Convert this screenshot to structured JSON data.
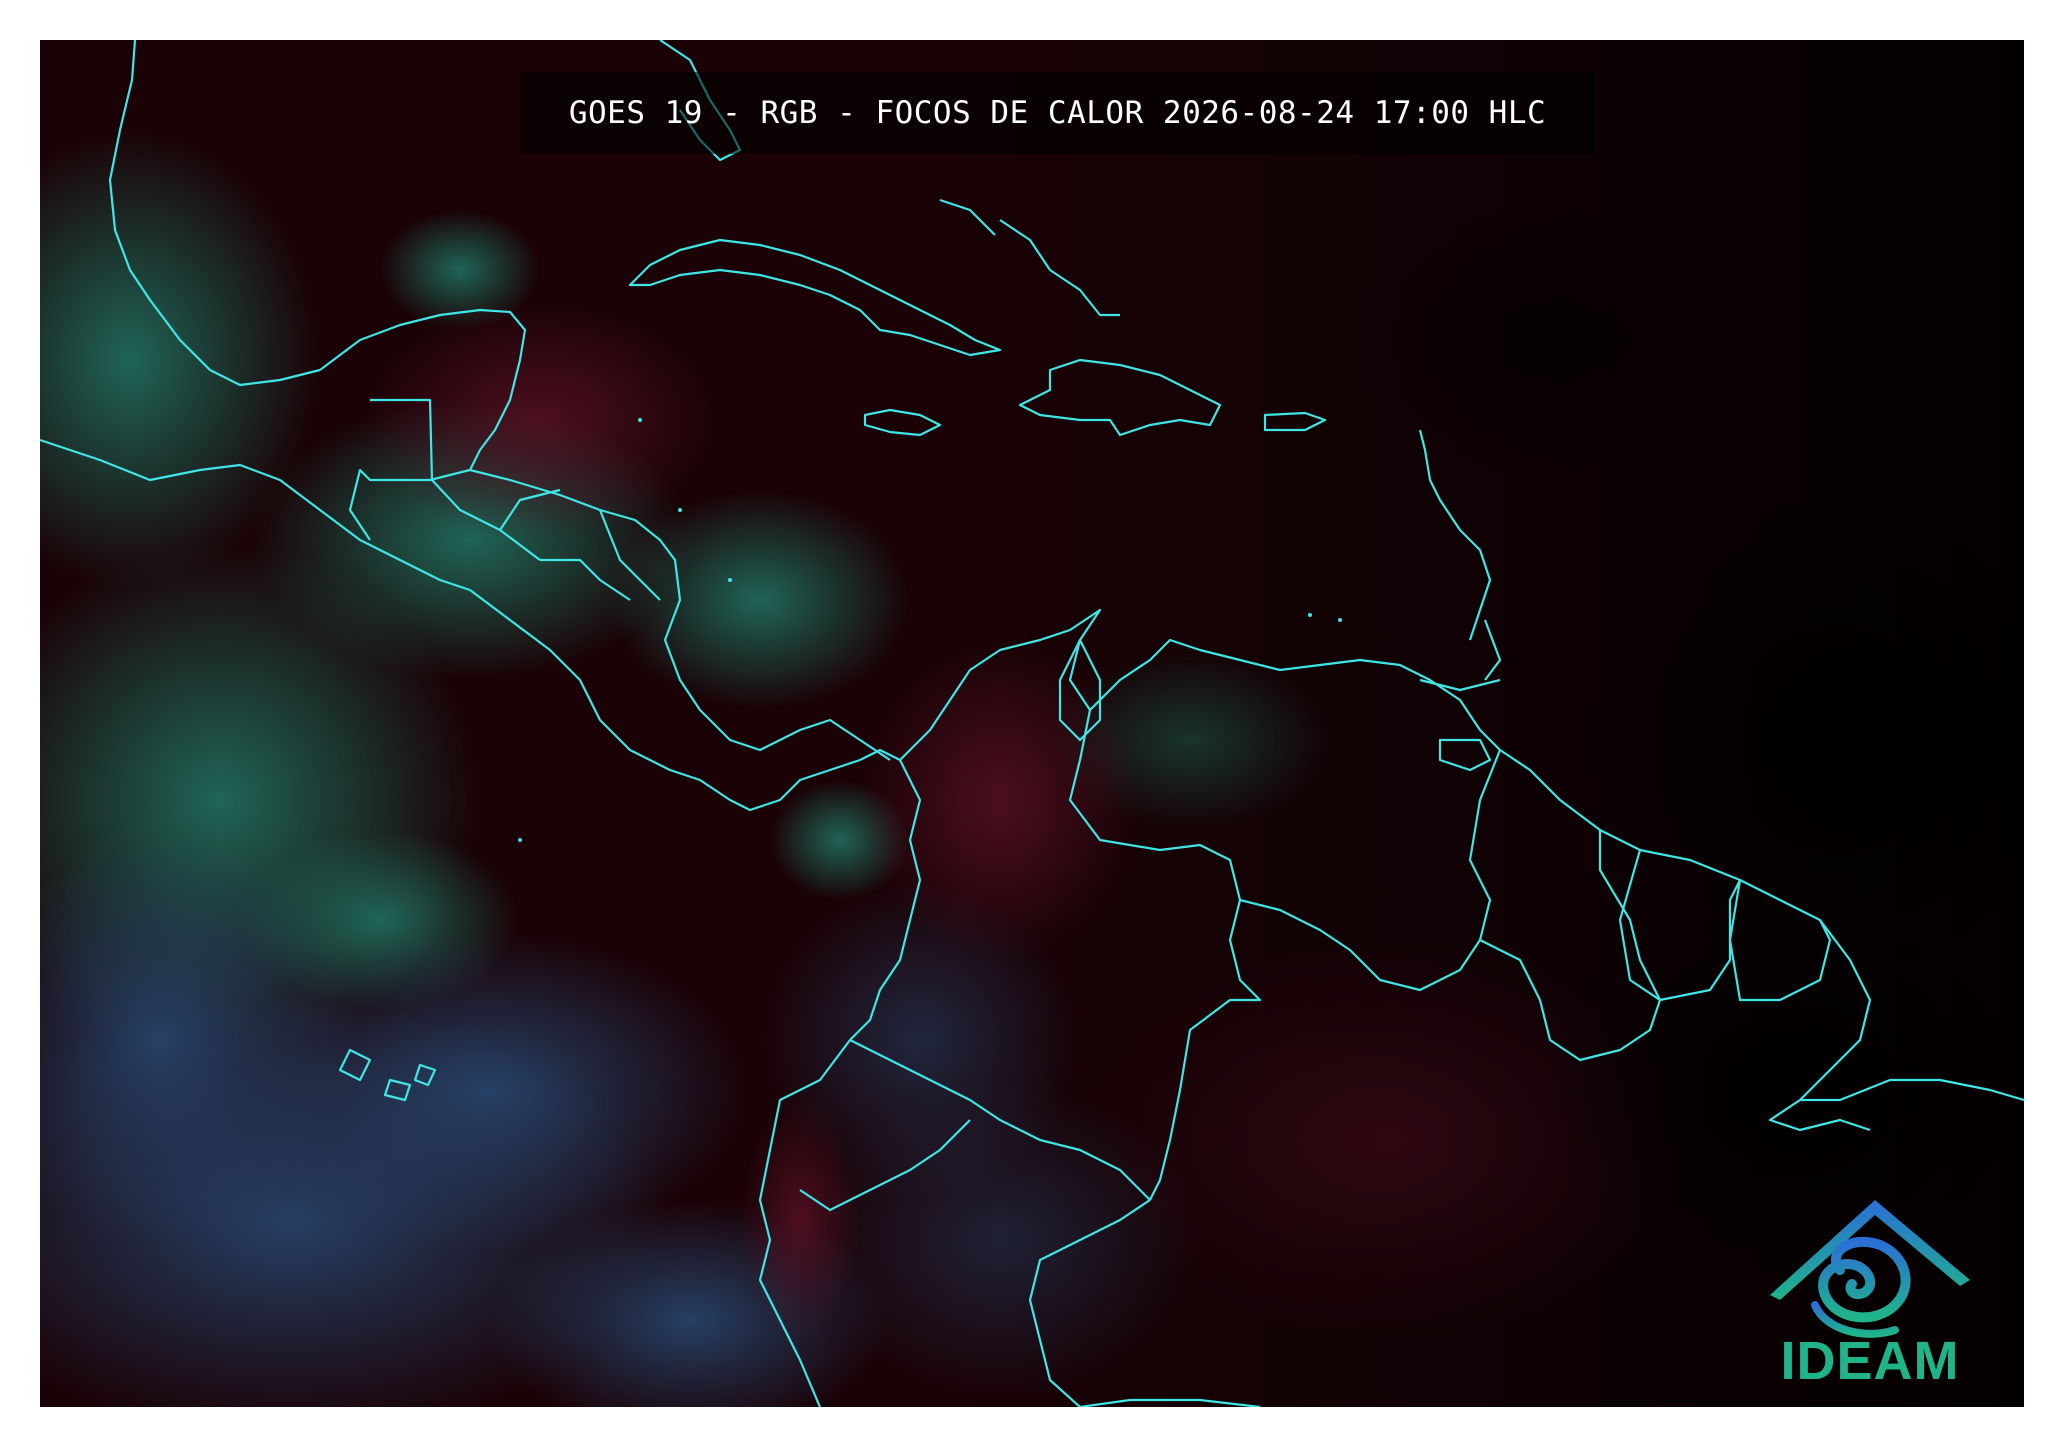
{
  "map": {
    "title": "GOES 19 - RGB - FOCOS DE CALOR 2026-08-24 17:00 HLC",
    "colors": {
      "background": "#1a0206",
      "border_lines": "#3fe6e6",
      "cloud_green": "#1c5a4e",
      "cloud_blue": "#1f3a5a",
      "land_red": "#3a0a18"
    }
  },
  "logo": {
    "text": "IDEAM",
    "icon": "ideam-mountain-swirl-icon",
    "colors": {
      "top": "#2a6fd6",
      "bottom": "#1fb48a"
    }
  }
}
